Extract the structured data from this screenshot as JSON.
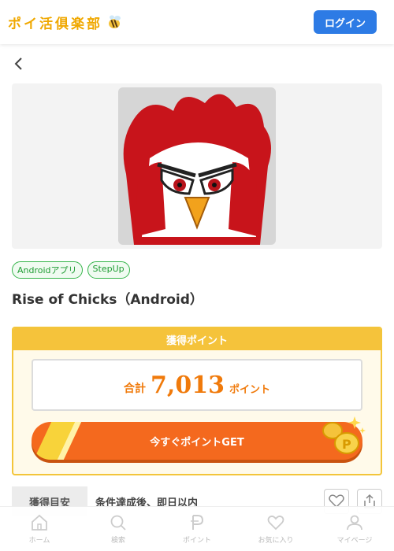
{
  "header": {
    "logo_text": "ポイ活俱楽部",
    "logo_icon": "bee-icon",
    "login_label": "ログイン"
  },
  "nav": {
    "back_icon": "chevron-left-icon"
  },
  "app": {
    "image_icon": "rooster-app-icon",
    "tags": [
      "Androidアプリ",
      "StepUp"
    ],
    "title": "Rise of Chicks（Android）"
  },
  "points": {
    "header": "獲得ポイント",
    "total_label": "合計",
    "total_value": "7,013",
    "unit": "ポイント",
    "cta_label": "今すぐポイントGET"
  },
  "estimate": {
    "label": "獲得目安",
    "value": "条件達成後、即日以内"
  },
  "actions": {
    "favorite_icon": "heart-icon",
    "share_icon": "share-icon"
  },
  "bottom_nav": [
    {
      "label": "ホーム",
      "icon": "home-icon"
    },
    {
      "label": "検索",
      "icon": "search-icon"
    },
    {
      "label": "ポイント",
      "icon": "point-icon"
    },
    {
      "label": "お気に入り",
      "icon": "heart-icon"
    },
    {
      "label": "マイページ",
      "icon": "person-icon"
    }
  ],
  "colors": {
    "brand_gold": "#f5c33b",
    "accent_orange": "#f07a0b",
    "cta_orange": "#f4691e",
    "login_blue": "#2d7be5",
    "tag_green": "#35b54a"
  }
}
